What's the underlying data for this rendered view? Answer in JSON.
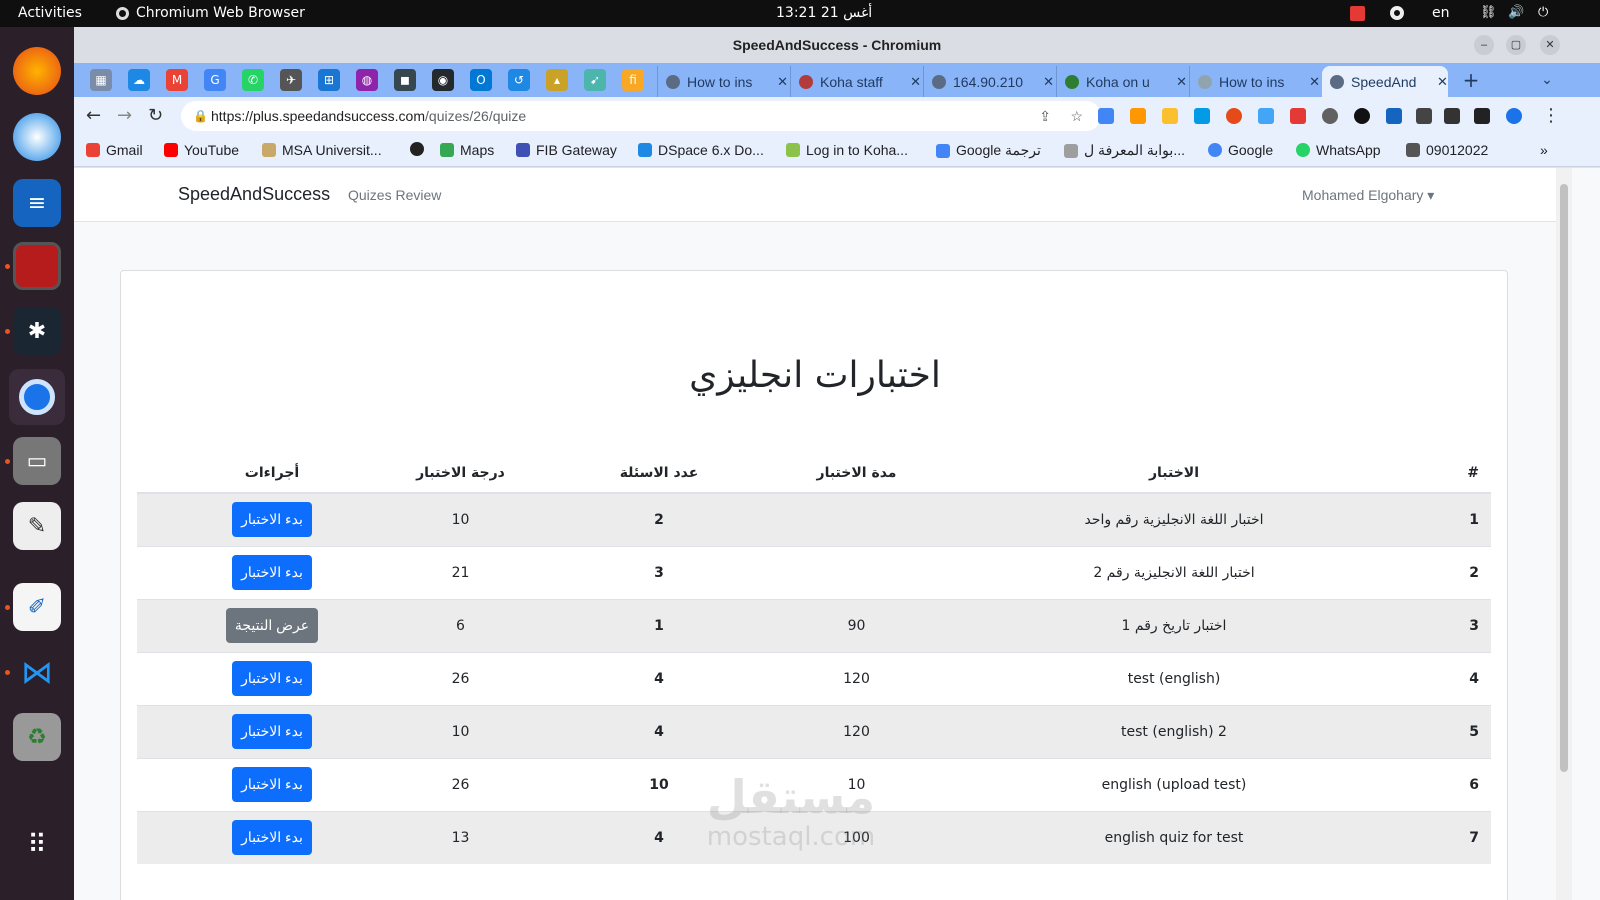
{
  "topbar": {
    "activities": "Activities",
    "app_name": "Chromium Web Browser",
    "datetime": "أغس 21  13:21",
    "lang": "en"
  },
  "window": {
    "title": "SpeedAndSuccess - Chromium",
    "minimize": "–",
    "maximize": "▢",
    "close": "✕"
  },
  "tabs": [
    {
      "label": "How to ins"
    },
    {
      "label": "Koha staff"
    },
    {
      "label": "164.90.210"
    },
    {
      "label": "Koha on u"
    },
    {
      "label": "How to ins"
    },
    {
      "label": "SpeedAnd"
    }
  ],
  "tab_close": "✕",
  "new_tab": "+",
  "tab_menu": "⌄",
  "toolbar": {
    "back": "←",
    "forward": "→",
    "reload": "↻",
    "url_host": "https://plus.speedandsuccess.com",
    "url_path": "/quizes/26/quize",
    "share": "⇪",
    "bookmark": "☆",
    "menu": "⋮"
  },
  "bookmarks": [
    {
      "label": "Gmail"
    },
    {
      "label": "YouTube"
    },
    {
      "label": "MSA Universit..."
    },
    {
      "label": "Maps"
    },
    {
      "label": "FIB Gateway"
    },
    {
      "label": "DSpace 6.x Do..."
    },
    {
      "label": "Log in to Koha..."
    },
    {
      "label": "Google ترجمة"
    },
    {
      "label": "بوابة المعرفة ل..."
    },
    {
      "label": "Google"
    },
    {
      "label": "WhatsApp"
    },
    {
      "label": "09012022"
    }
  ],
  "bookmarks_more": "»",
  "site": {
    "brand": "SpeedAndSuccess",
    "nav_link": "Quizes Review",
    "user": "Mohamed Elgohary ▾"
  },
  "page": {
    "heading": "اختبارات انجليزي",
    "columns": {
      "num": "#",
      "name": "الاختبار",
      "duration": "مدة الاختبار",
      "count": "عدد الاسئلة",
      "grade": "درجة الاختبار",
      "actions": "أجراءات"
    },
    "rows": [
      {
        "num": "1",
        "name": "اختبار اللغة الانجليزية رقم واحد",
        "duration": "",
        "count": "2",
        "grade": "10",
        "action": "بدء الاختبار",
        "style": "primary"
      },
      {
        "num": "2",
        "name": "اختبار اللغة الانجليزية رقم 2",
        "duration": "",
        "count": "3",
        "grade": "21",
        "action": "بدء الاختبار",
        "style": "primary"
      },
      {
        "num": "3",
        "name": "اختبار تاريخ رقم 1",
        "duration": "90",
        "count": "1",
        "grade": "6",
        "action": "عرض النتيجة",
        "style": "secondary"
      },
      {
        "num": "4",
        "name": "test (english)",
        "duration": "120",
        "count": "4",
        "grade": "26",
        "action": "بدء الاختبار",
        "style": "primary"
      },
      {
        "num": "5",
        "name": "test (english) 2",
        "duration": "120",
        "count": "4",
        "grade": "10",
        "action": "بدء الاختبار",
        "style": "primary"
      },
      {
        "num": "6",
        "name": "english (upload test)",
        "duration": "10",
        "count": "10",
        "grade": "26",
        "action": "بدء الاختبار",
        "style": "primary"
      },
      {
        "num": "7",
        "name": "english quiz for test",
        "duration": "100",
        "count": "4",
        "grade": "13",
        "action": "بدء الاختبار",
        "style": "primary"
      }
    ]
  },
  "watermark": {
    "arabic": "مستقل",
    "latin": "mostaql.com"
  },
  "colors": {
    "primary": "#0d6efd",
    "secondary": "#6c757d",
    "tabstrip": "#8ab4f8"
  }
}
